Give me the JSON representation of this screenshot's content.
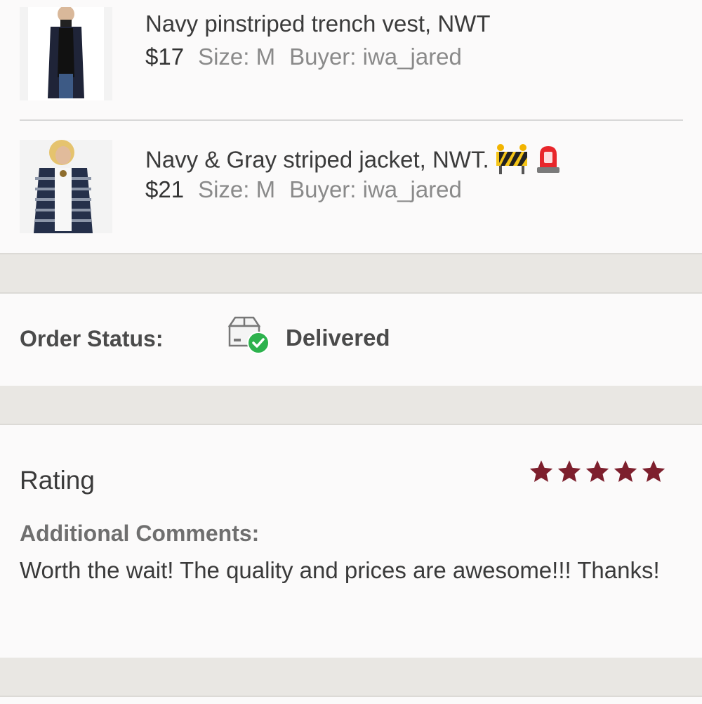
{
  "items": [
    {
      "title": "Navy pinstriped trench vest, NWT",
      "price": "$17",
      "size": "Size: M",
      "buyer": "Buyer: iwa_jared",
      "emojis": []
    },
    {
      "title": "Navy & Gray striped jacket, NWT.",
      "price": "$21",
      "size": "Size: M",
      "buyer": "Buyer: iwa_jared",
      "emojis": [
        "construction-barrier-emoji",
        "police-light-emoji"
      ]
    }
  ],
  "order_status": {
    "label": "Order Status:",
    "value": "Delivered",
    "icon": "package-delivered-icon",
    "icon_check_color": "#2db24d"
  },
  "rating": {
    "title": "Rating",
    "stars": 5,
    "max_stars": 5,
    "star_color": "#7d1f2d",
    "comments_label": "Additional Comments:",
    "comment_text": "Worth the wait! The quality and prices are awesome!!! Thanks!"
  }
}
